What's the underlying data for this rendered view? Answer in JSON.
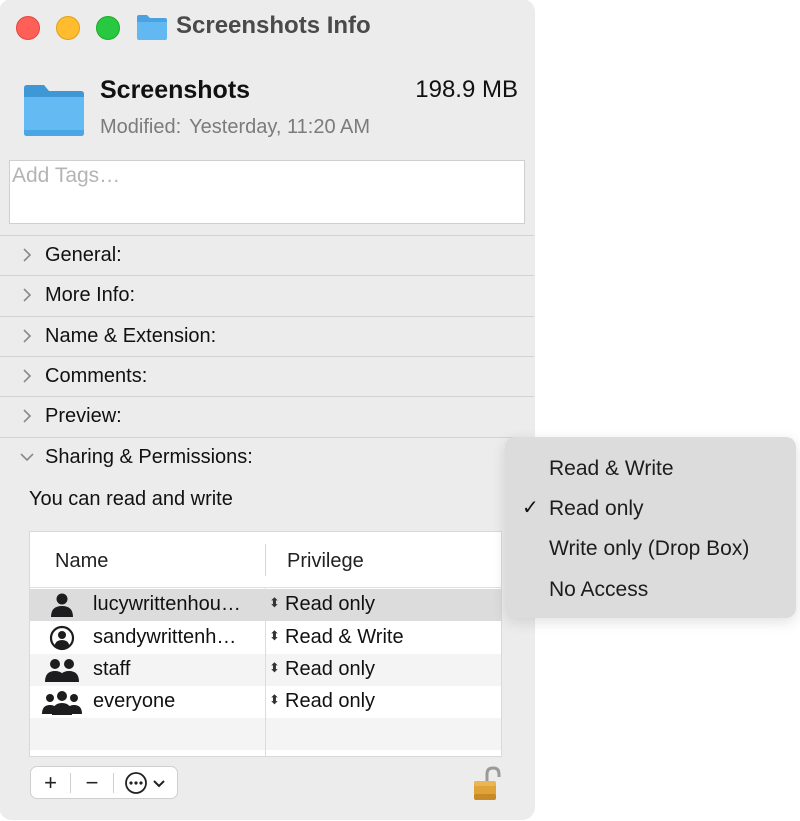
{
  "window": {
    "title": "Screenshots Info"
  },
  "header": {
    "name": "Screenshots",
    "size": "198.9 MB",
    "modified_label": "Modified:",
    "modified_value": "Yesterday, 11:20 AM"
  },
  "tags": {
    "placeholder": "Add Tags…",
    "value": ""
  },
  "sections": [
    {
      "label": "General:",
      "expanded": false
    },
    {
      "label": "More Info:",
      "expanded": false
    },
    {
      "label": "Name & Extension:",
      "expanded": false
    },
    {
      "label": "Comments:",
      "expanded": false
    },
    {
      "label": "Preview:",
      "expanded": false
    },
    {
      "label": "Sharing & Permissions:",
      "expanded": true
    }
  ],
  "sharing": {
    "summary": "You can read and write",
    "columns": [
      "Name",
      "Privilege"
    ],
    "rows": [
      {
        "name": "lucywrittenhou…",
        "privilege": "Read only",
        "icon": "person-icon",
        "selected": true
      },
      {
        "name": "sandywrittenh…",
        "privilege": "Read & Write",
        "icon": "person-circle-icon",
        "selected": false
      },
      {
        "name": "staff",
        "privilege": "Read only",
        "icon": "group-icon",
        "selected": false
      },
      {
        "name": "everyone",
        "privilege": "Read only",
        "icon": "everyone-icon",
        "selected": false
      }
    ]
  },
  "toolbar": {
    "add_label": "+",
    "remove_label": "−",
    "action_label": "⋯"
  },
  "privilege_menu": {
    "items": [
      "Read & Write",
      "Read only",
      "Write only (Drop Box)",
      "No Access"
    ],
    "checked": "Read only",
    "check_glyph": "✓"
  }
}
